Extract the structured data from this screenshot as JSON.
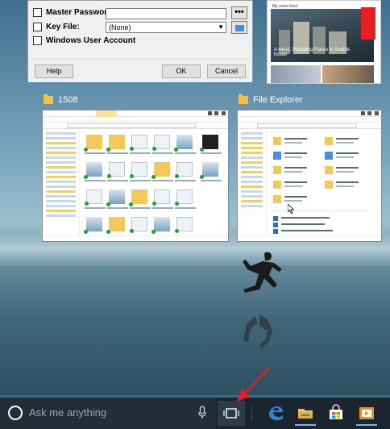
{
  "keepass": {
    "master_password_label": "Master Password:",
    "dots_label": "•••",
    "key_file_label": "Key File:",
    "key_file_value": "(None)",
    "windows_account_label": "Windows User Account",
    "help_label": "Help",
    "ok_label": "OK",
    "cancel_label": "Cancel"
  },
  "news": {
    "header": "My news feed",
    "hero_caption": "A weird, Plumbing Fiasco in Seattle hostel"
  },
  "task_view": {
    "windows": [
      {
        "title": "1508"
      },
      {
        "title": "File Explorer"
      }
    ]
  },
  "taskbar": {
    "search_placeholder": "Ask me anything",
    "apps": [
      "task-view",
      "edge",
      "file-explorer",
      "store",
      "media"
    ]
  },
  "colors": {
    "taskbar": "#1b2530",
    "accent": "#7fb3e0",
    "arrow": "#e02020",
    "folder": "#f2c85b"
  }
}
